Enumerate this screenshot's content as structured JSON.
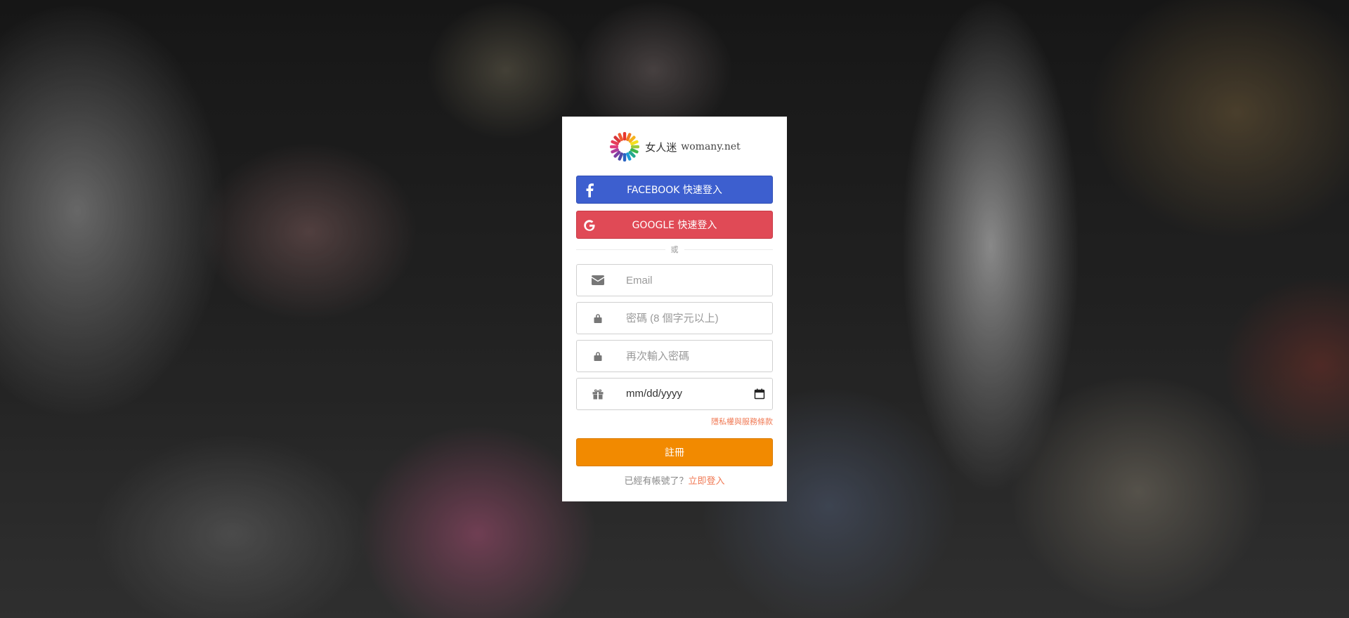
{
  "brand": {
    "name_cn": "女人迷",
    "name_en": "womany.net"
  },
  "social": {
    "facebook_label": "FACEBOOK 快速登入",
    "google_label": "GOOGLE 快速登入"
  },
  "divider_text": "或",
  "form": {
    "email_placeholder": "Email",
    "password_placeholder": "密碼 (8 個字元以上)",
    "password_confirm_placeholder": "再次輸入密碼",
    "birthday_value": "mm/dd/yyyy"
  },
  "privacy_link": "隱私權與服務條款",
  "submit_label": "註冊",
  "login_prompt": "已經有帳號了？",
  "login_link": "立即登入",
  "colors": {
    "facebook": "#3d5fcf",
    "google": "#e04a56",
    "submit": "#f28a00",
    "link": "#f07a55"
  },
  "icons": {
    "facebook": "facebook-icon",
    "google": "google-icon",
    "email": "envelope-icon",
    "password": "lock-icon",
    "password_confirm": "lock-icon",
    "birthday": "gift-icon",
    "date_picker": "calendar-icon"
  }
}
